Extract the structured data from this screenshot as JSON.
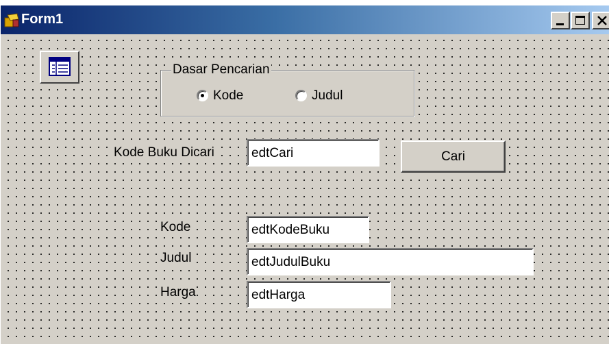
{
  "window": {
    "title": "Form1",
    "icon": "delphi-form-icon",
    "caption_buttons": [
      "minimize-icon",
      "maximize-icon",
      "close-icon"
    ]
  },
  "form": {
    "component_icon": "table-component-icon",
    "search_group": {
      "caption": "Dasar Pencarian",
      "options": [
        {
          "label": "Kode",
          "selected": true
        },
        {
          "label": "Judul",
          "selected": false
        }
      ]
    },
    "search": {
      "label": "Kode Buku Dicari",
      "input_value": "edtCari",
      "button_label": "Cari"
    },
    "fields": [
      {
        "label": "Kode",
        "value": "edtKodeBuku"
      },
      {
        "label": "Judul",
        "value": "edtJudulBuku"
      },
      {
        "label": "Harga",
        "value": "edtHarga"
      }
    ]
  }
}
